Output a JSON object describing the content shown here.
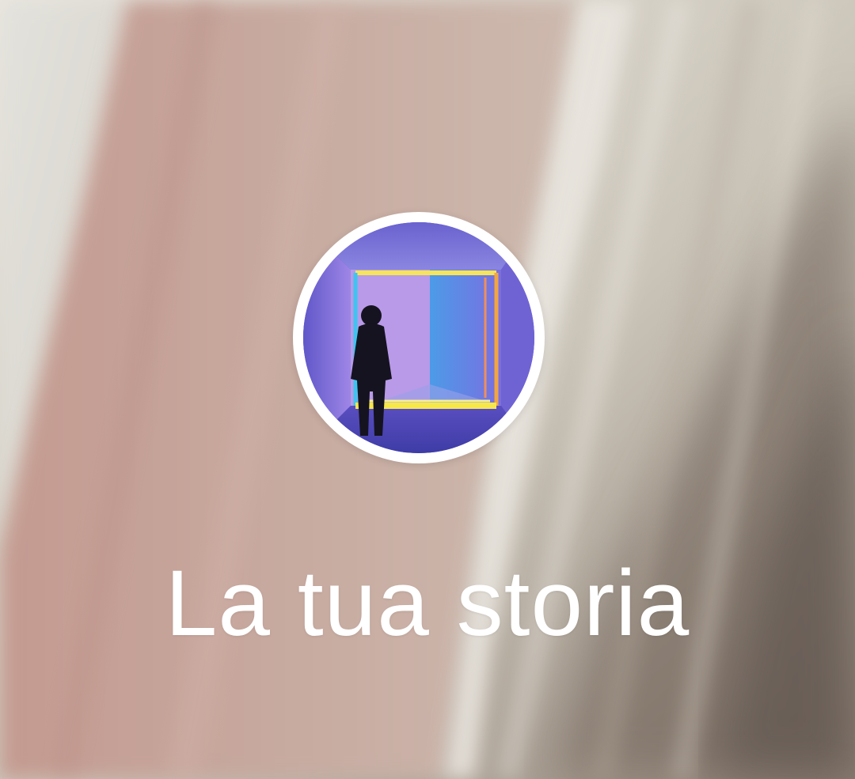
{
  "story_tile": {
    "label": "La tua storia",
    "avatar_icon": "profile-photo",
    "add_story_action": "create-story"
  },
  "colors": {
    "ring": "#ffffff",
    "label": "#ffffff",
    "background_left": "#c4a49b",
    "background_right": "#d9d6ce",
    "avatar_primary": "#6a6fd8",
    "avatar_accent": "#f3e24a"
  }
}
